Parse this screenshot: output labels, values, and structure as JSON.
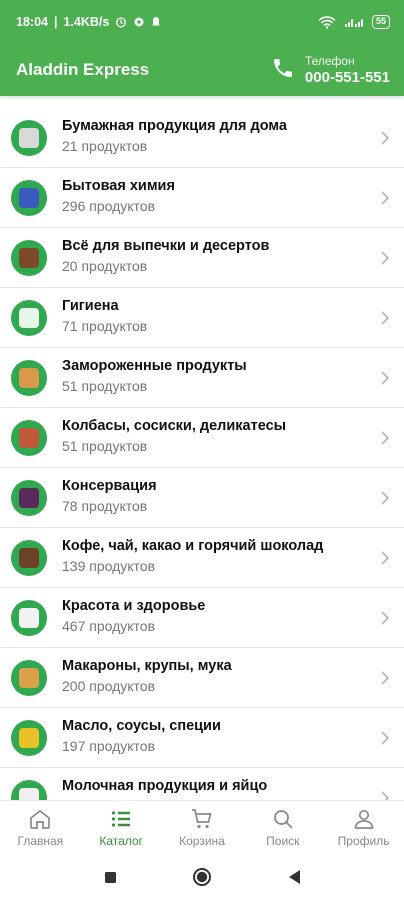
{
  "status_bar": {
    "time": "18:04",
    "network_speed": "1.4KB/s",
    "battery": "55"
  },
  "header": {
    "title": "Aladdin Express",
    "phone_label": "Телефон",
    "phone_number": "000-551-551"
  },
  "categories": [
    {
      "title": "Бумажная продукция для дома",
      "count": "21 продуктов",
      "icon": "paper-towel-icon",
      "color": "#d9d9d9"
    },
    {
      "title": "Бытовая химия",
      "count": "296 продуктов",
      "icon": "detergent-bottle-icon",
      "color": "#3b5bbf"
    },
    {
      "title": "Всё для выпечки и десертов",
      "count": "20 продуктов",
      "icon": "baking-box-icon",
      "color": "#7a4a2a"
    },
    {
      "title": "Гигиена",
      "count": "71 продуктов",
      "icon": "toothbrush-cup-icon",
      "color": "#e8f5e9"
    },
    {
      "title": "Замороженные продукты",
      "count": "51 продуктов",
      "icon": "ice-cream-icon",
      "color": "#d89a4a"
    },
    {
      "title": "Колбасы, сосиски, деликатесы",
      "count": "51 продуктов",
      "icon": "sausage-icon",
      "color": "#c0583a"
    },
    {
      "title": "Консервация",
      "count": "78 продуктов",
      "icon": "jar-icon",
      "color": "#5a2a5a"
    },
    {
      "title": "Кофе, чай, какао и горячий шоколад",
      "count": "139 продуктов",
      "icon": "coffee-cup-icon",
      "color": "#6b4226"
    },
    {
      "title": "Красота и здоровье",
      "count": "467 продуктов",
      "icon": "cotton-pads-icon",
      "color": "#f2f2f2"
    },
    {
      "title": "Макароны, крупы, мука",
      "count": "200 продуктов",
      "icon": "pasta-pack-icon",
      "color": "#d9a24a"
    },
    {
      "title": "Масло, соусы, специи",
      "count": "197 продуктов",
      "icon": "oil-bottle-icon",
      "color": "#e8c227"
    },
    {
      "title": "Молочная продукция и яйцо",
      "count": "",
      "icon": "milk-icon",
      "color": "#f0f0f0"
    }
  ],
  "bottom_nav": [
    {
      "label": "Главная",
      "icon": "home-icon",
      "active": false
    },
    {
      "label": "Каталог",
      "icon": "list-icon",
      "active": true
    },
    {
      "label": "Корзина",
      "icon": "cart-icon",
      "active": false
    },
    {
      "label": "Поиск",
      "icon": "search-icon",
      "active": false
    },
    {
      "label": "Профиль",
      "icon": "profile-icon",
      "active": false
    }
  ],
  "colors": {
    "brand_green": "#4caf50",
    "active_nav": "#3d8e3f",
    "icon_circle": "#2fa84f"
  }
}
